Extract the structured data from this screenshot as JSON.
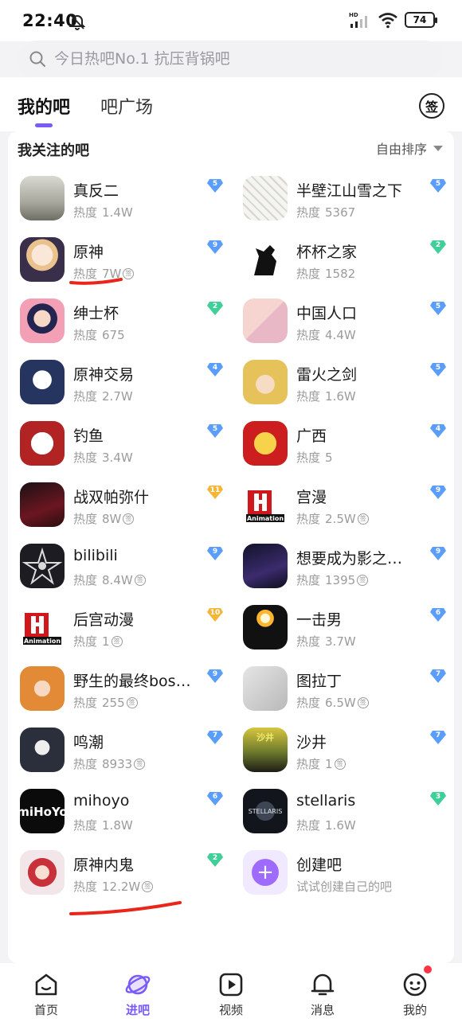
{
  "status_bar": {
    "time": "22:40",
    "network": "HD",
    "battery": "74"
  },
  "search": {
    "placeholder": "今日热吧No.1 抗压背锅吧"
  },
  "tabs": [
    {
      "label": "我的吧",
      "active": true
    },
    {
      "label": "吧广场",
      "active": false
    }
  ],
  "sign_button_label": "签",
  "section": {
    "title": "我关注的吧",
    "sort_label": "自由排序"
  },
  "heat_label": "热度",
  "sign_glyph": "签",
  "colors": {
    "accent": "#7a5af8",
    "level_blue": "#5b9dfb",
    "level_green": "#3fcf98",
    "level_gold": "#f5b536",
    "annotation_red": "#e8261b"
  },
  "forums": [
    {
      "name": "真反二",
      "heat": "1.4W",
      "level": "5",
      "tier": "blue",
      "signed": false,
      "avatar": "grey-landscape"
    },
    {
      "name": "半壁江山雪之下",
      "heat": "5367",
      "level": "5",
      "tier": "blue",
      "signed": false,
      "avatar": "manga-sketch"
    },
    {
      "name": "原神",
      "heat": "7W",
      "level": "9",
      "tier": "blue",
      "signed": true,
      "avatar": "anime-girl-genshin"
    },
    {
      "name": "杯杯之家",
      "heat": "1582",
      "level": "2",
      "tier": "green",
      "signed": false,
      "avatar": "black-horse"
    },
    {
      "name": "绅士杯",
      "heat": "675",
      "level": "2",
      "tier": "green",
      "signed": false,
      "avatar": "anime-girl-pink"
    },
    {
      "name": "中国人口",
      "heat": "4.4W",
      "level": "5",
      "tier": "blue",
      "signed": false,
      "avatar": "baby-photos"
    },
    {
      "name": "原神交易",
      "heat": "2.7W",
      "level": "4",
      "tier": "blue",
      "signed": false,
      "avatar": "paimon"
    },
    {
      "name": "雷火之剑",
      "heat": "1.6W",
      "level": "5",
      "tier": "blue",
      "signed": false,
      "avatar": "blonde-anime"
    },
    {
      "name": "钓鱼",
      "heat": "3.4W",
      "level": "5",
      "tier": "blue",
      "signed": false,
      "avatar": "fish-emblem"
    },
    {
      "name": "广西",
      "heat": "5",
      "level": "4",
      "tier": "blue",
      "signed": false,
      "avatar": "red-map-emblem"
    },
    {
      "name": "战双帕弥什",
      "heat": "8W",
      "level": "11",
      "tier": "gold",
      "signed": true,
      "avatar": "dark-red-anime"
    },
    {
      "name": "宫漫",
      "heat": "2.5W",
      "level": "9",
      "tier": "blue",
      "signed": true,
      "avatar": "animation-h-logo"
    },
    {
      "name": "bilibili",
      "heat": "8.4W",
      "level": "9",
      "tier": "blue",
      "signed": true,
      "avatar": "star-emblem"
    },
    {
      "name": "想要成为影之实力者",
      "heat": "1395",
      "level": "9",
      "tier": "blue",
      "signed": true,
      "avatar": "shadow-purple"
    },
    {
      "name": "后宫动漫",
      "heat": "1",
      "level": "10",
      "tier": "gold",
      "signed": true,
      "avatar": "animation-h-logo"
    },
    {
      "name": "一击男",
      "heat": "3.7W",
      "level": "6",
      "tier": "blue",
      "signed": false,
      "avatar": "planet-glow"
    },
    {
      "name": "野生的最终boss出现了",
      "heat": "255",
      "level": "9",
      "tier": "blue",
      "signed": true,
      "avatar": "orange-anime"
    },
    {
      "name": "图拉丁",
      "heat": "6.5W",
      "level": "7",
      "tier": "blue",
      "signed": true,
      "avatar": "cpu-chip"
    },
    {
      "name": "鸣潮",
      "heat": "8933",
      "level": "7",
      "tier": "blue",
      "signed": true,
      "avatar": "dark-hair-anime"
    },
    {
      "name": "沙井",
      "heat": "1",
      "level": "7",
      "tier": "blue",
      "signed": true,
      "avatar": "crowd-yellow"
    },
    {
      "name": "mihoyo",
      "heat": "1.8W",
      "level": "6",
      "tier": "blue",
      "signed": false,
      "avatar": "mihoyo-logo"
    },
    {
      "name": "stellaris",
      "heat": "1.6W",
      "level": "3",
      "tier": "green",
      "signed": false,
      "avatar": "stellaris-logo"
    },
    {
      "name": "原神内鬼",
      "heat": "12.2W",
      "level": "2",
      "tier": "green",
      "signed": true,
      "avatar": "nilou-anime"
    }
  ],
  "create": {
    "title": "创建吧",
    "subtitle": "试试创建自己的吧"
  },
  "bottom_nav": [
    {
      "label": "首页",
      "icon": "home-icon",
      "active": false
    },
    {
      "label": "进吧",
      "icon": "planet-icon",
      "active": true
    },
    {
      "label": "视频",
      "icon": "video-icon",
      "active": false
    },
    {
      "label": "消息",
      "icon": "bell-icon",
      "active": false
    },
    {
      "label": "我的",
      "icon": "face-icon",
      "active": false,
      "badge": true
    }
  ]
}
